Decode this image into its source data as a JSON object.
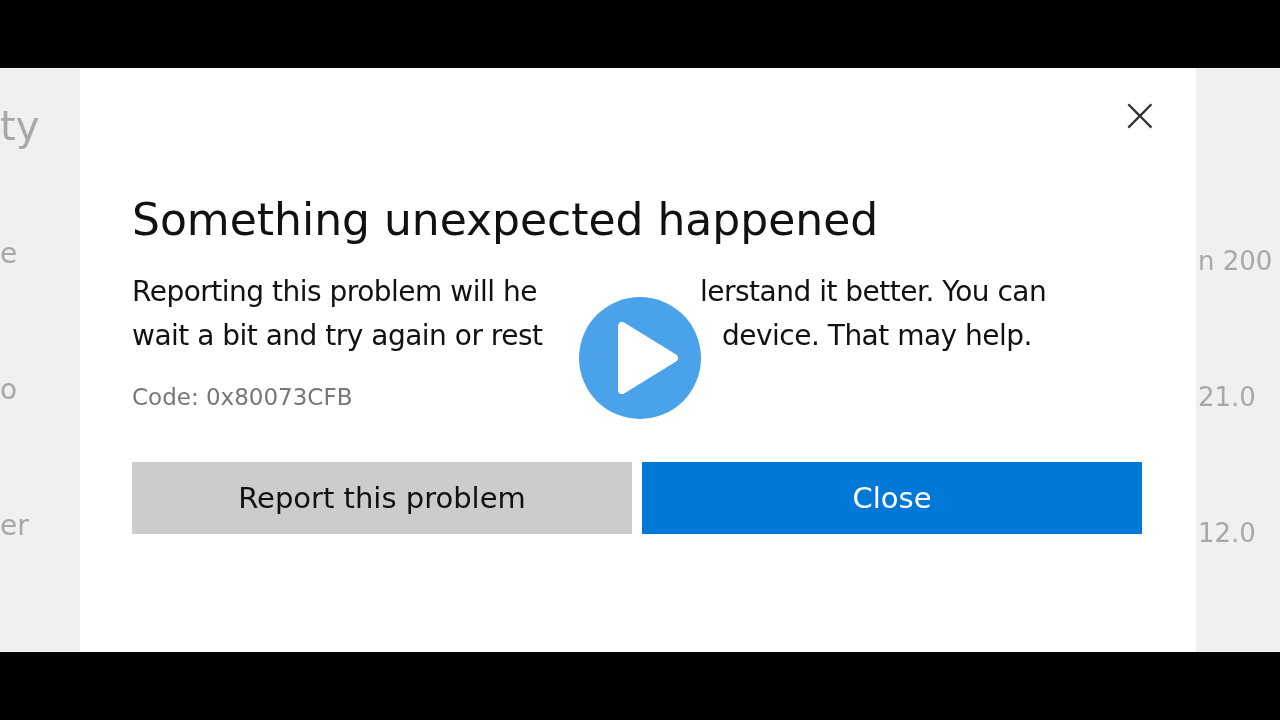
{
  "background": {
    "left_texts": [
      "ty",
      "e",
      "o",
      "er"
    ],
    "right_texts": [
      "n 200",
      "21.0",
      "12.0"
    ]
  },
  "dialog": {
    "close": "×",
    "title": "Something unexpected happened",
    "message_lines": [
      [
        "Reporting this problem will he",
        "lerstand it better. You can"
      ],
      [
        "wait a bit and try again or rest",
        "device. That may help."
      ]
    ],
    "code": "Code: 0x80073CFB",
    "buttons": [
      {
        "label": "Report this problem",
        "kind": "secondary"
      },
      {
        "label": "Close",
        "kind": "primary"
      }
    ]
  },
  "video": {
    "play_button": true
  }
}
